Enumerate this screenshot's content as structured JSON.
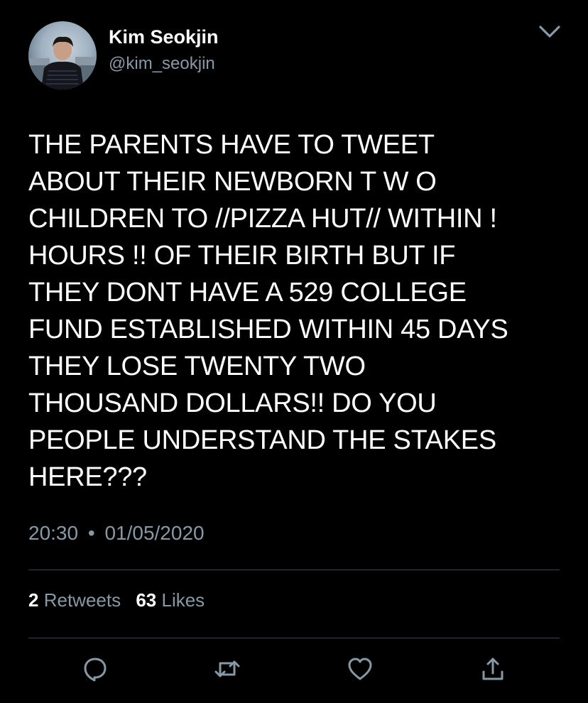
{
  "user": {
    "display_name": "Kim Seokjin",
    "handle": "@kim_seokjin",
    "avatar_icon": "profile-photo"
  },
  "header": {
    "menu_icon": "chevron-down-icon"
  },
  "tweet": {
    "lines": [
      "THE PARENTS HAVE TO TWEET",
      "ABOUT THEIR NEWBORN T W O",
      "CHILDREN TO //PIZZA HUT// WITHIN !",
      "HOURS !! OF THEIR BIRTH BUT IF",
      "THEY DONT HAVE A 529 COLLEGE",
      "FUND ESTABLISHED WITHIN 45 DAYS",
      "THEY LOSE TWENTY TWO",
      "THOUSAND DOLLARS!! DO YOU",
      "PEOPLE UNDERSTAND THE STAKES",
      "HERE???"
    ],
    "time": "20:30",
    "separator": "•",
    "date": "01/05/2020"
  },
  "stats": {
    "retweets_count": "2",
    "retweets_label": "Retweets",
    "likes_count": "63",
    "likes_label": "Likes"
  },
  "actions": [
    "reply-icon",
    "retweet-icon",
    "like-icon",
    "share-icon"
  ],
  "colors": {
    "background": "#000000",
    "text": "#ffffff",
    "secondary_text": "#8899a6",
    "divider": "#38444d"
  }
}
